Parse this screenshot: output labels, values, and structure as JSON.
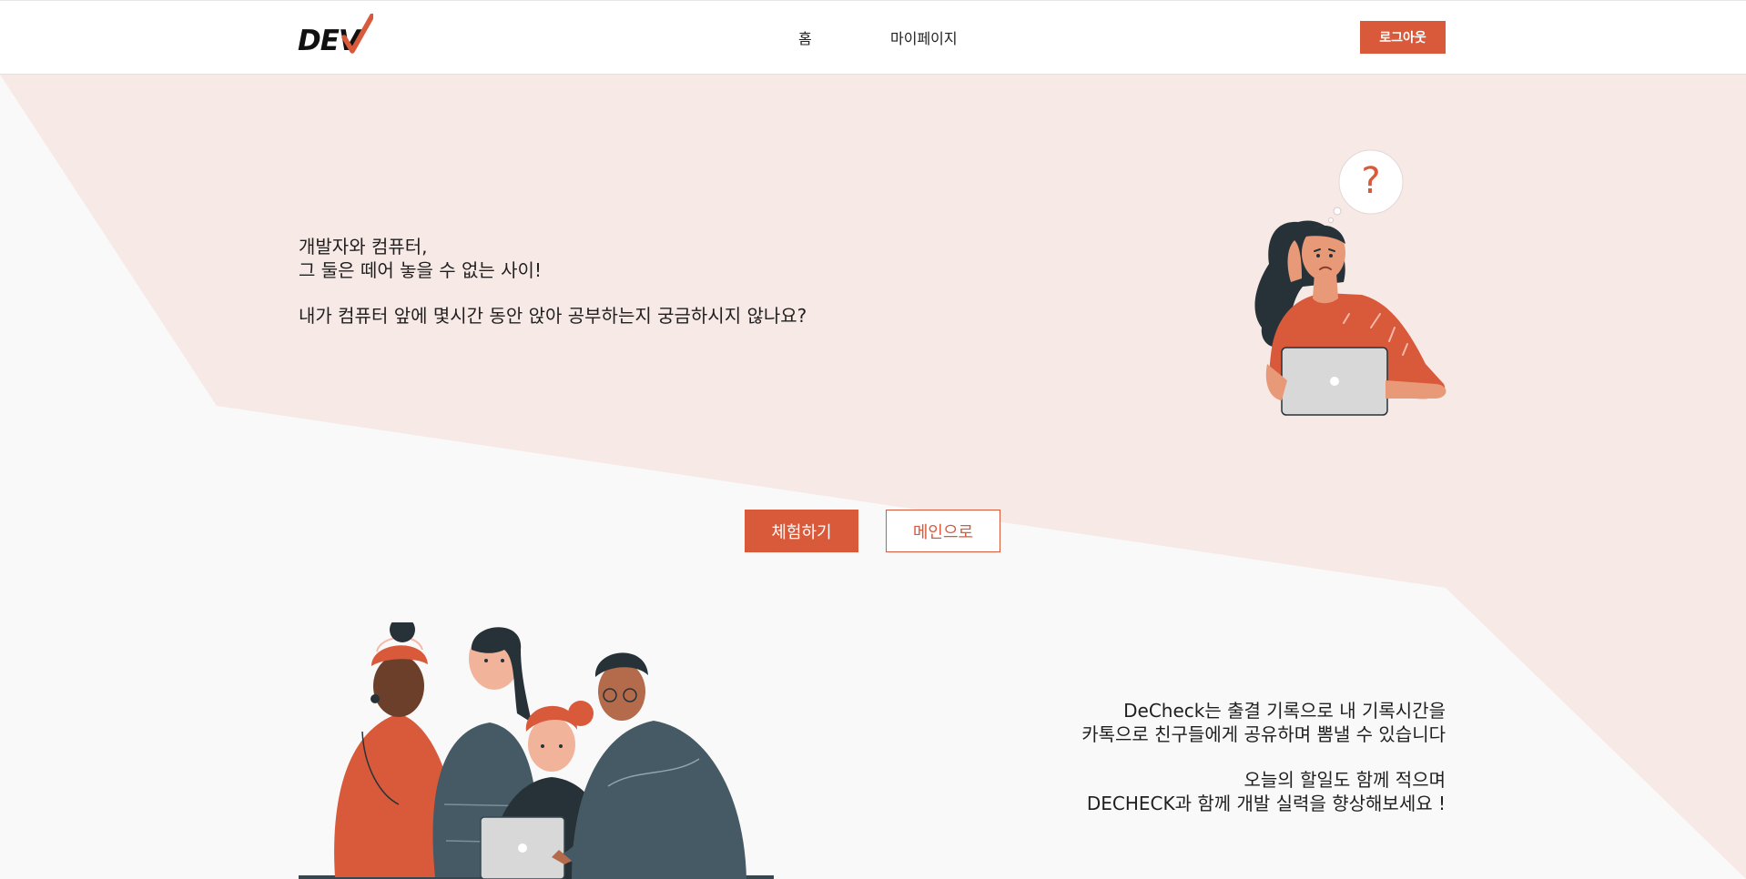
{
  "header": {
    "logo_text": "DEV",
    "nav": {
      "home": "홈",
      "mypage": "마이페이지"
    },
    "logout_label": "로그아웃"
  },
  "hero": {
    "line1": "개발자와 컴퓨터,",
    "line2": "그 둘은 떼어 놓을 수 없는 사이!",
    "line3": "내가 컴퓨터 앞에 몇시간 동안 앉아 공부하는지 궁금하시지 않나요?",
    "thought_symbol": "?"
  },
  "actions": {
    "try_label": "체험하기",
    "main_label": "메인으로"
  },
  "feature": {
    "line1": "DeCheck는 출결 기록으로 내 기록시간을",
    "line2": "카톡으로 친구들에게 공유하며 뽐낼 수 있습니다",
    "line3": "오늘의 할일도 함께 적으며",
    "line4": "DECHECK과 함께 개발 실력을 향상해보세요 !"
  },
  "colors": {
    "accent": "#d9593b",
    "background": "#faf9f9",
    "band": "#f7e9e5",
    "text": "#1f1f1f"
  },
  "icons": {
    "logo": "dev-check-logo-icon",
    "hero_illustration": "thinking-woman-laptop-illustration",
    "team_illustration": "team-laptop-illustration"
  }
}
